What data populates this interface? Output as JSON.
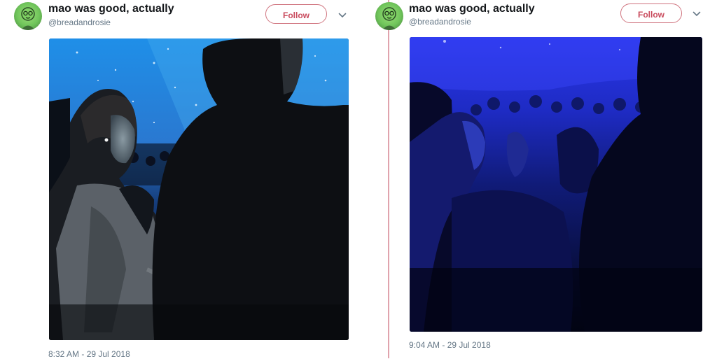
{
  "tweets": [
    {
      "display_name": "mao was good, actually",
      "handle": "@breadandrosie",
      "follow_label": "Follow",
      "timestamp": "8:32 AM - 29 Jul 2018",
      "avatar_icon": "avatar-illustration",
      "menu_icon": "chevron-down-icon"
    },
    {
      "display_name": "mao was good, actually",
      "handle": "@breadandrosie",
      "follow_label": "Follow",
      "timestamp": "9:04 AM - 29 Jul 2018",
      "avatar_icon": "avatar-illustration",
      "menu_icon": "chevron-down-icon"
    }
  ],
  "colors": {
    "follow_accent": "#c94b5d",
    "divider": "#e0a3ad",
    "secondary_text": "#657786"
  }
}
